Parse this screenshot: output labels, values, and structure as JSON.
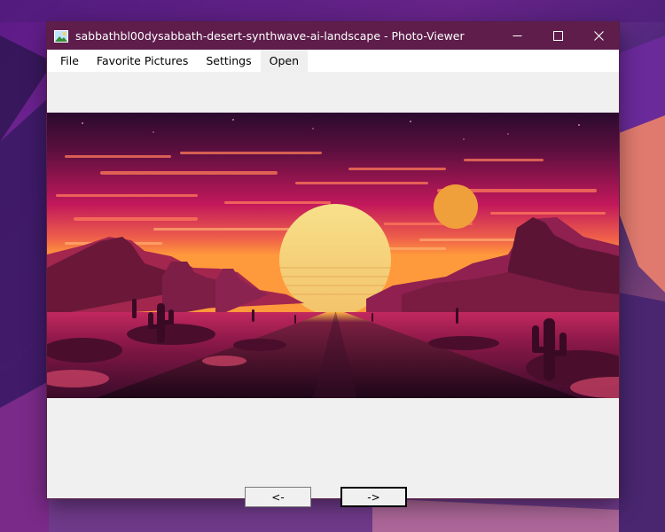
{
  "window": {
    "title": "sabbathbl00dysabbath-desert-synthwave-ai-landscape - Photo-Viewer",
    "controls": {
      "minimize_glyph": "minimize-icon",
      "maximize_glyph": "maximize-icon",
      "close_glyph": "close-icon"
    }
  },
  "menu": {
    "items": [
      "File",
      "Favorite Pictures",
      "Settings",
      "Open"
    ]
  },
  "photo": {
    "subject": "desert synthwave landscape",
    "colors": {
      "sky_top": "#2a0a2e",
      "sky_mid": "#c2185b",
      "horizon": "#ff9a3c",
      "sun": "#f7d77a",
      "small_sun": "#f0a03a",
      "ground": "#3a0b2a",
      "road": "#1e0618"
    }
  },
  "navigation": {
    "prev_label": "<-",
    "next_label": "->"
  },
  "colors": {
    "titlebar": "#5e1d4b",
    "window_bg": "#f0f0f0",
    "menubar_bg": "#ffffff"
  }
}
